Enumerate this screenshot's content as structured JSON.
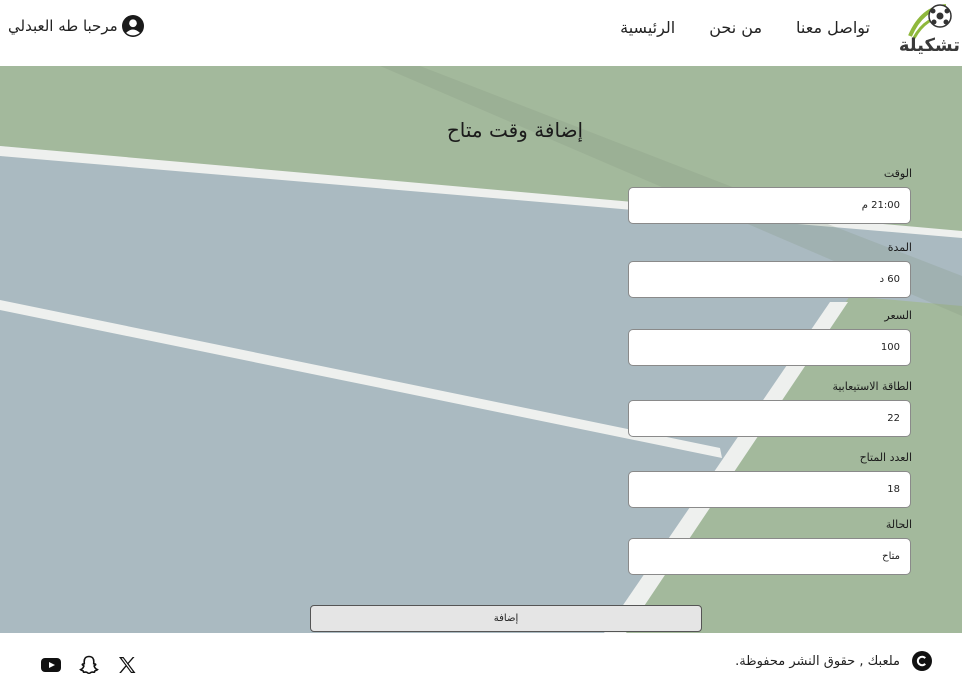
{
  "header": {
    "logo_text": "تشكيلة",
    "nav": [
      "الرئيسية",
      "من نحن",
      "تواصل معنا"
    ],
    "user_greeting": "مرحبا طه العبدلي"
  },
  "form": {
    "title": "إضافة وقت متاح",
    "fields": [
      {
        "label": "الوقت",
        "value": "21:00 م"
      },
      {
        "label": "المدة",
        "value": "60 د"
      },
      {
        "label": "السعر",
        "value": "100"
      },
      {
        "label": "الطاقة الاستيعابية",
        "value": "22"
      },
      {
        "label": "العدد المتاح",
        "value": "18"
      },
      {
        "label": "الحالة",
        "value": "متاح"
      }
    ],
    "submit_label": "إضافة"
  },
  "footer": {
    "copyright": "ملعبك , حقوق النشر محفوظة.",
    "social_icons": [
      "youtube-icon",
      "snapchat-icon",
      "x-icon"
    ]
  },
  "colors": {
    "court_green": "#9eb596",
    "court_blue": "#a7b8c0",
    "line": "#f3f3f3"
  }
}
